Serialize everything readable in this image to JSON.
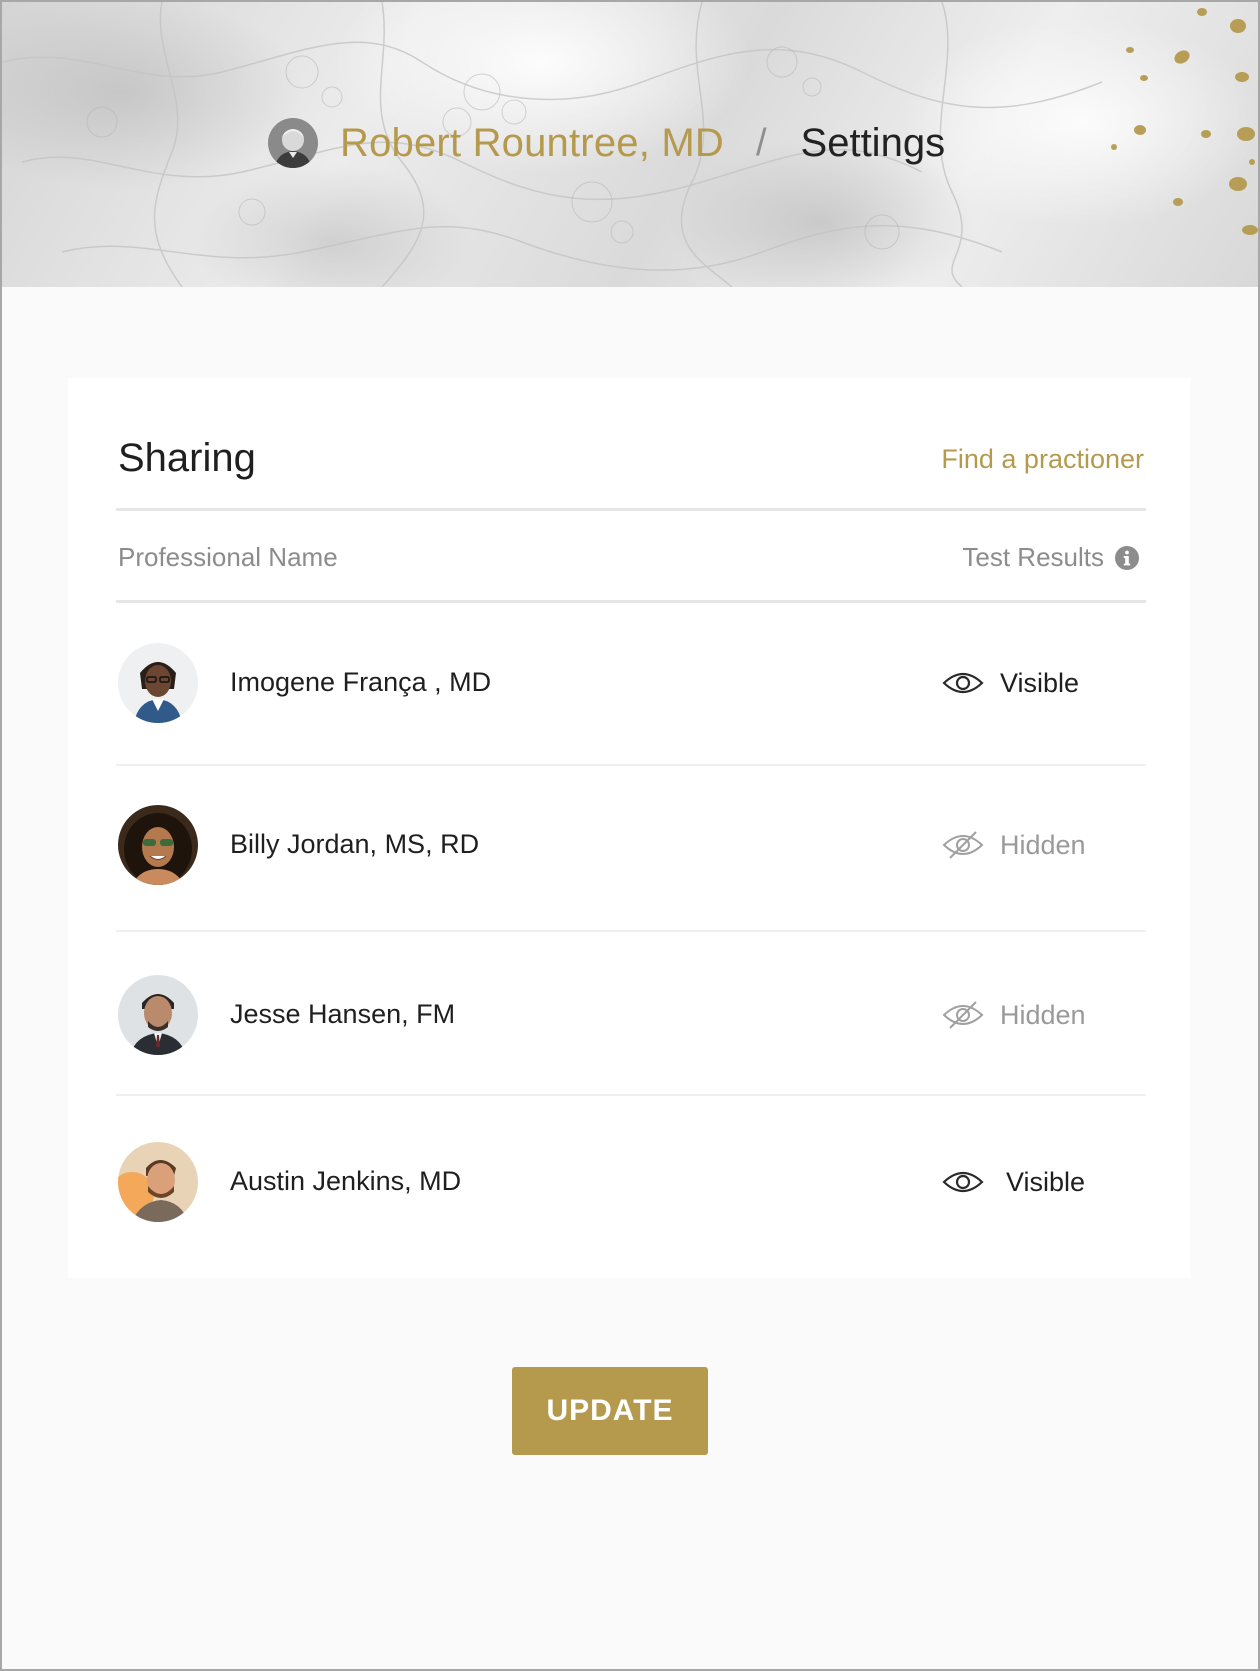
{
  "header": {
    "user_name": "Robert Rountree, MD",
    "separator": "/",
    "page_title": "Settings"
  },
  "sharing": {
    "title": "Sharing",
    "find_link": "Find a practioner",
    "columns": {
      "name": "Professional Name",
      "results": "Test Results"
    },
    "professionals": [
      {
        "name": "Imogene França , MD",
        "status": "Visible",
        "icon": "eye-icon"
      },
      {
        "name": "Billy Jordan, MS, RD",
        "status": "Hidden",
        "icon": "eye-slash-icon"
      },
      {
        "name": "Jesse Hansen, FM",
        "status": "Hidden",
        "icon": "eye-slash-icon"
      },
      {
        "name": "Austin Jenkins, MD",
        "status": "Visible",
        "icon": "eye-icon"
      }
    ]
  },
  "update_button": "UPDATE",
  "colors": {
    "accent_gold": "#b59a4e",
    "text_dark": "#1f1f1f",
    "text_muted": "#8c8c8c",
    "background": "#fafafa"
  }
}
